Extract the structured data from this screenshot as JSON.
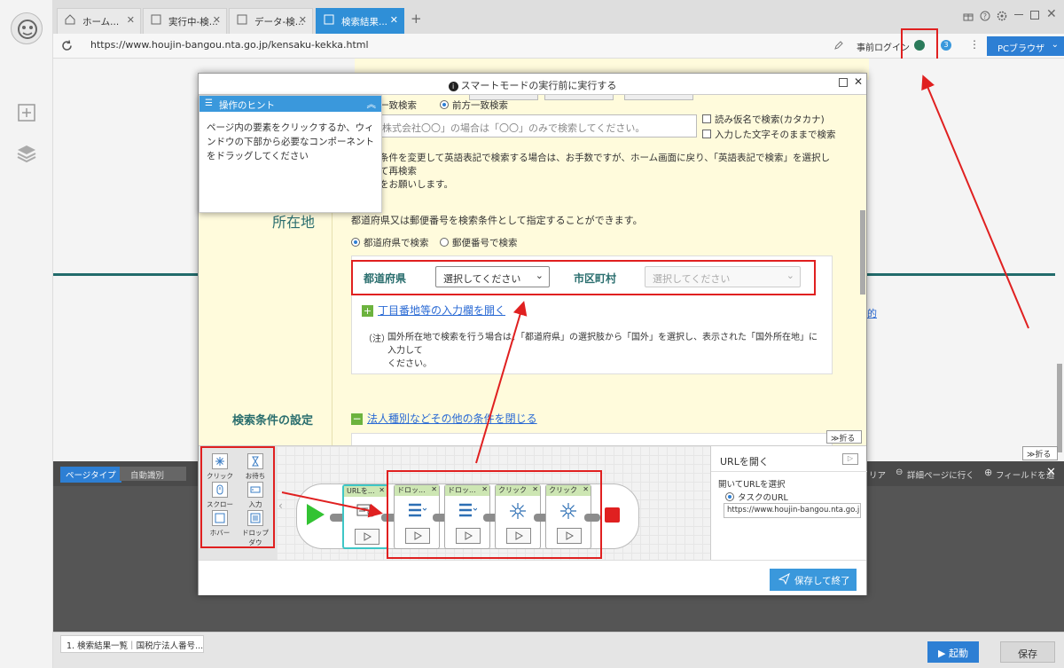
{
  "browser": {
    "tabs": [
      {
        "label": "ホーム..."
      },
      {
        "label": "実行中-検..."
      },
      {
        "label": "データ-検..."
      },
      {
        "label": "検索結果..."
      }
    ],
    "new_tab": "+",
    "url": "https://www.houjin-bangou.nta.go.jp/kensaku-kekka.html",
    "pre_login": "事前ログイン",
    "pc_browser": "PCブラウザ",
    "fold_label": "折る",
    "link_fragment": "的"
  },
  "workspace": {
    "page_type_label": "ページタイプ",
    "page_type_value": "自動識別",
    "link_action": "詳細ページに行く",
    "add_field": "フィールドを追",
    "fragment": "リア",
    "page_tab": "1. 検索結果一覧｜国税庁法人番号...",
    "start_button": "起動",
    "save_button": "保存"
  },
  "dialog": {
    "title": "スマートモードの実行前に実行する",
    "hint": {
      "title": "操作のヒント",
      "body": "ページ内の要素をクリックするか、ウィンドウの下部から必要なコンポーネントをドラッグしてください"
    },
    "page": {
      "tabs_top": [
        "",
        "",
        ""
      ],
      "match_exact": "一致検索",
      "match_prefix": "前方一致検索",
      "name_placeholder": "株式会社〇〇」の場合は「〇〇」のみで検索してください。",
      "kana_search": "読み仮名で検索(カタカナ)",
      "exact_text": "入力した文字そのままで検索",
      "english_note": "条件を変更して英語表記で検索する場合は、お手数ですが、ホーム画面に戻り、「英語表記で検索」を選択して再検索",
      "english_note2": "をお願いします。",
      "location_heading": "所在地",
      "location_desc": "都道府県又は郵便番号を検索条件として指定することができます。",
      "radio_pref": "都道府県で検索",
      "radio_zip": "郵便番号で検索",
      "pref_label": "都道府県",
      "pref_select": "選択してください",
      "city_label": "市区町村",
      "city_select": "選択してください",
      "open_block": "丁目番地等の入力欄を開く",
      "note_prefix": "（注）",
      "note_text": "国外所在地で検索を行う場合は、「都道府県」の選択肢から「国外」を選択し、表示された「国外所在地」に入力して",
      "note_text2": "ください。",
      "conditions_heading": "検索条件の設定",
      "conditions_link": "法人種別などその他の条件を閉じる",
      "fold": "折る"
    },
    "tools": [
      {
        "label": "クリック",
        "icon": "click-icon"
      },
      {
        "label": "お待ち",
        "icon": "hourglass-icon"
      },
      {
        "label": "スクロール",
        "icon": "scroll-icon"
      },
      {
        "label": "入力",
        "icon": "input-icon"
      },
      {
        "label": "ホバー",
        "icon": "hover-icon"
      },
      {
        "label": "ドロップダウ",
        "icon": "dropdown-icon"
      }
    ],
    "nodes": [
      {
        "label": "URLを...",
        "icon": "url-icon"
      },
      {
        "label": "ドロッ...",
        "icon": "dropdown-icon"
      },
      {
        "label": "ドロッ...",
        "icon": "dropdown-icon"
      },
      {
        "label": "クリック",
        "icon": "click-icon"
      },
      {
        "label": "クリック",
        "icon": "click-icon"
      }
    ],
    "properties": {
      "title": "URLを開く",
      "open_label": "開いてURLを選択",
      "task_url_label": "タスクのURL",
      "task_url_value": "https://www.houjin-bangou.nta.go.jp/ke"
    },
    "save_exit": "保存して終了"
  },
  "colors": {
    "accent": "#2d7fd4",
    "highlight": "#e02020",
    "page_bg": "#fffbdc",
    "heading_green": "#2a6e6e"
  }
}
